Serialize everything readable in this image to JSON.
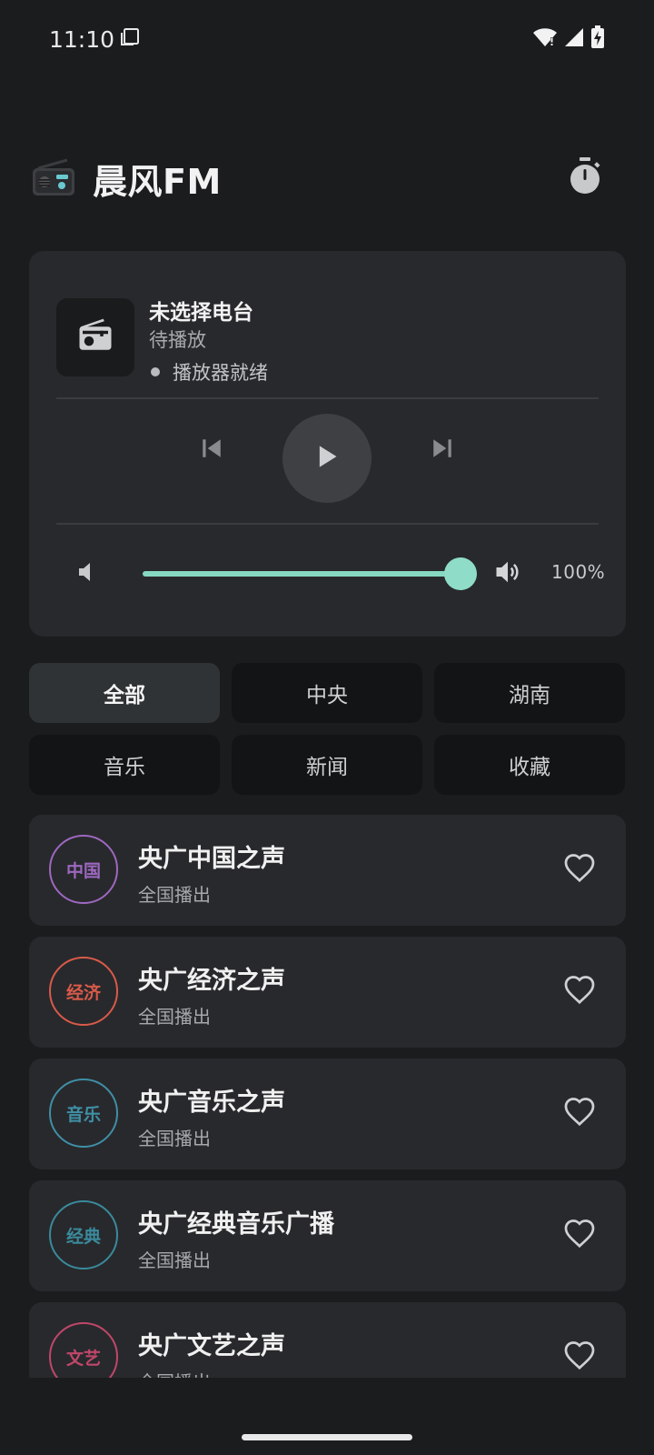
{
  "status_bar": {
    "time": "11:10"
  },
  "header": {
    "title": "晨风FM"
  },
  "player": {
    "title": "未选择电台",
    "subtitle": "待播放",
    "status": "播放器就绪",
    "volume_percent": 100,
    "volume_label": "100%"
  },
  "filters": [
    "全部",
    "中央",
    "湖南",
    "音乐",
    "新闻",
    "收藏"
  ],
  "selected_filter": "全部",
  "stations": [
    {
      "badge": "中国",
      "name": "央广中国之声",
      "region": "全国播出",
      "color": "#9d68c0"
    },
    {
      "badge": "经济",
      "name": "央广经济之声",
      "region": "全国播出",
      "color": "#d95a4a"
    },
    {
      "badge": "音乐",
      "name": "央广音乐之声",
      "region": "全国播出",
      "color": "#3f8fa6"
    },
    {
      "badge": "经典",
      "name": "央广经典音乐广播",
      "region": "全国播出",
      "color": "#3a8a9c"
    },
    {
      "badge": "文艺",
      "name": "央广文艺之声",
      "region": "全国播出",
      "color": "#c0476a"
    }
  ],
  "colors": {
    "accent": "#86d8c2",
    "background": "#1b1c1e",
    "card": "#28292c"
  }
}
